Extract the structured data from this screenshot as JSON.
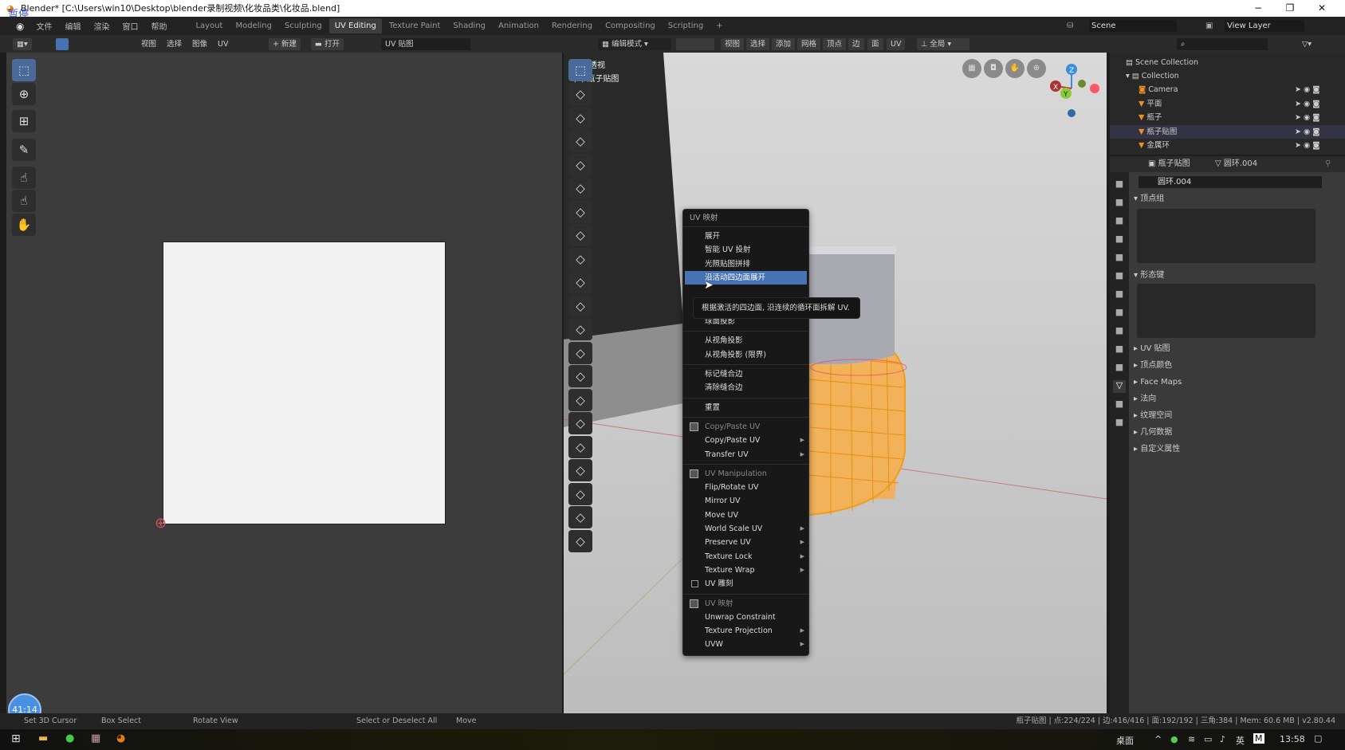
{
  "window": {
    "title": "Blender* [C:\\Users\\win10\\Desktop\\blender录制视频\\化妆品类\\化妆品.blend]",
    "overlay_badge": "暂停",
    "minimize": "−",
    "restore": "❐",
    "close": "✕"
  },
  "menubar": [
    "文件",
    "编辑",
    "渲染",
    "窗口",
    "帮助"
  ],
  "workspaces": [
    {
      "label": "Layout"
    },
    {
      "label": "Modeling"
    },
    {
      "label": "Sculpting"
    },
    {
      "label": "UV Editing",
      "active": true
    },
    {
      "label": "Texture Paint"
    },
    {
      "label": "Shading"
    },
    {
      "label": "Animation"
    },
    {
      "label": "Rendering"
    },
    {
      "label": "Compositing"
    },
    {
      "label": "Scripting"
    },
    {
      "label": "+"
    }
  ],
  "scene": {
    "label": "Scene",
    "view_layer": "View Layer"
  },
  "uv_header": {
    "menus": [
      "视图",
      "选择",
      "图像",
      "UV"
    ],
    "new": "新建",
    "open": "打开",
    "image_name": "UV 贴图"
  },
  "view3d_header": {
    "mode": "编辑模式",
    "menus": [
      "视图",
      "选择",
      "添加",
      "网格",
      "顶点",
      "边",
      "面",
      "UV"
    ],
    "transform": "全局"
  },
  "viewport": {
    "view_name": "用户透视",
    "object_label": "(1) 瓶子贴图",
    "gizmo": {
      "x": "X",
      "y": "Y",
      "z": "Z"
    }
  },
  "context_menu": {
    "title": "UV 映射",
    "items": [
      {
        "label": "展开"
      },
      {
        "label": "智能 UV 投射"
      },
      {
        "label": "光照贴图拼排"
      },
      {
        "label": "沿活动四边面展开",
        "highlighted": true
      },
      {
        "type": "gap"
      },
      {
        "label": "球面投影"
      },
      {
        "type": "sep"
      },
      {
        "label": "从视角投影"
      },
      {
        "label": "从视角投影 (限界)"
      },
      {
        "type": "sep"
      },
      {
        "label": "标记缝合边"
      },
      {
        "label": "清除缝合边"
      },
      {
        "type": "sep"
      },
      {
        "label": "重置"
      },
      {
        "type": "sep"
      },
      {
        "label": "Copy/Paste UV",
        "header": true
      },
      {
        "label": "Copy/Paste UV",
        "submenu": true
      },
      {
        "label": "Transfer UV",
        "submenu": true
      },
      {
        "type": "sep"
      },
      {
        "label": "UV Manipulation",
        "header": true
      },
      {
        "label": "Flip/Rotate UV"
      },
      {
        "label": "Mirror UV"
      },
      {
        "label": "Move UV"
      },
      {
        "label": "World Scale UV",
        "submenu": true
      },
      {
        "label": "Preserve UV",
        "submenu": true
      },
      {
        "label": "Texture Lock",
        "submenu": true
      },
      {
        "label": "Texture Wrap",
        "submenu": true
      },
      {
        "label": "UV 雕刻",
        "checkbox": true
      },
      {
        "type": "sep"
      },
      {
        "label": "UV 映射",
        "header": true
      },
      {
        "label": "Unwrap Constraint"
      },
      {
        "label": "Texture Projection",
        "submenu": true
      },
      {
        "label": "UVW",
        "submenu": true
      }
    ],
    "tooltip": "根据激活的四边面, 沿连续的循环面拆解 UV."
  },
  "outliner": {
    "root": "Scene Collection",
    "collection": "Collection",
    "objects": [
      {
        "name": "Camera",
        "type": "camera"
      },
      {
        "name": "平面",
        "type": "mesh"
      },
      {
        "name": "瓶子",
        "type": "mesh"
      },
      {
        "name": "瓶子贴图",
        "type": "mesh",
        "active": true
      },
      {
        "name": "金属环",
        "type": "mesh"
      }
    ]
  },
  "properties": {
    "object": "瓶子贴图",
    "mesh": "圆环.004",
    "data_field": "圆环.004",
    "open_panels": [
      "顶点组",
      "形态键"
    ],
    "closed_panels": [
      "UV 贴图",
      "顶点颜色",
      "Face Maps",
      "法向",
      "纹理空间",
      "几何数据",
      "自定义属性"
    ]
  },
  "statusbar": {
    "left": [
      "Set 3D Cursor",
      "Box Select",
      "Rotate View",
      "Select or Deselect All",
      "Move"
    ],
    "stats": "瓶子贴图 | 点:224/224 | 边:416/416 | 面:192/192 | 三角:384 | Mem: 60.6 MB | v2.80.44",
    "timer": "41:14"
  },
  "taskbar": {
    "desktop": "桌面",
    "ime": "英",
    "ime2": "M",
    "clock": "13:58"
  }
}
